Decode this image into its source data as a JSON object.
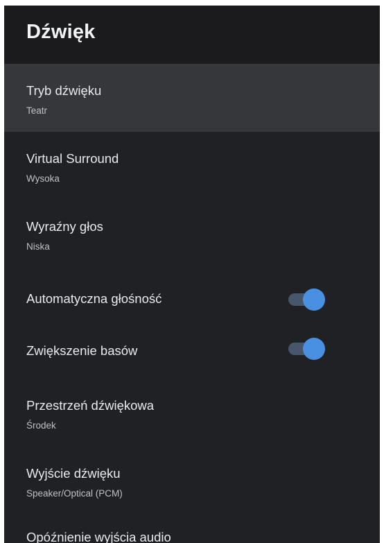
{
  "header": {
    "title": "Dźwięk"
  },
  "colors": {
    "background": "#202124",
    "header_background": "#1b1b1d",
    "selected_background": "#36373a",
    "toggle_on": "#4a90e2"
  },
  "settings": [
    {
      "title": "Tryb dźwięku",
      "value": "Teatr",
      "selected": true
    },
    {
      "title": "Virtual Surround",
      "value": "Wysoka"
    },
    {
      "title": "Wyraźny głos",
      "value": "Niska"
    },
    {
      "title": "Automatyczna głośność",
      "toggle": true
    },
    {
      "title": "Zwiększenie basów",
      "toggle": true
    },
    {
      "title": "Przestrzeń dźwiękowa",
      "value": "Środek"
    },
    {
      "title": "Wyjście dźwięku",
      "value": "Speaker/Optical (PCM)"
    },
    {
      "title": "Opóźnienie wyjścia audio"
    }
  ]
}
